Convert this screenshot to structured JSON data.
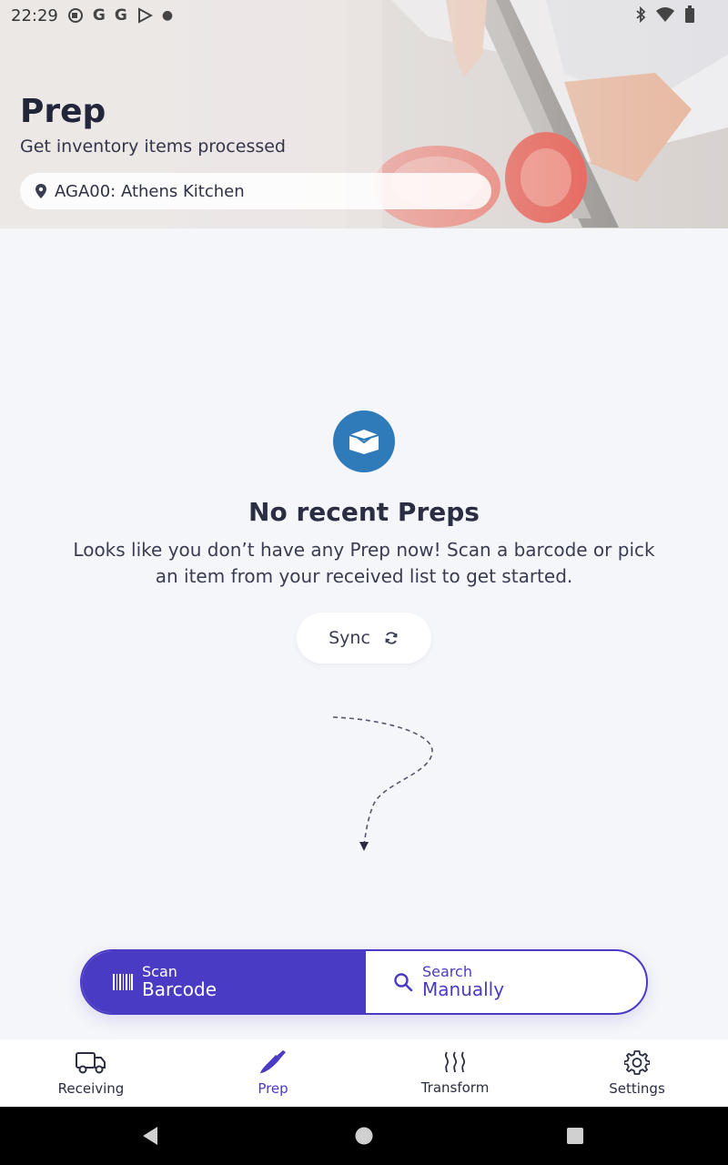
{
  "status_bar": {
    "time": "22:29",
    "icons": [
      "recording-icon",
      "google-icon",
      "google-icon",
      "play-store-icon",
      "dot-icon",
      "bluetooth-icon",
      "wifi-icon",
      "battery-icon"
    ]
  },
  "header": {
    "title": "Prep",
    "subtitle": "Get inventory items processed",
    "location": "AGA00: Athens Kitchen"
  },
  "empty_state": {
    "title": "No recent Preps",
    "description": "Looks like you don’t have any Prep now! Scan a barcode or pick an item from your received list to get started.",
    "sync_label": "Sync"
  },
  "actions": {
    "scan_small": "Scan",
    "scan_big": "Barcode",
    "search_small": "Search",
    "search_big": "Manually"
  },
  "nav": {
    "items": [
      {
        "label": "Receiving",
        "icon": "truck-icon",
        "active": false
      },
      {
        "label": "Prep",
        "icon": "knife-icon",
        "active": true
      },
      {
        "label": "Transform",
        "icon": "steam-icon",
        "active": false
      },
      {
        "label": "Settings",
        "icon": "gear-icon",
        "active": false
      }
    ]
  },
  "colors": {
    "accent": "#4a3bc4",
    "empty_icon": "#2f7ab8",
    "background": "#f5f6fa"
  }
}
